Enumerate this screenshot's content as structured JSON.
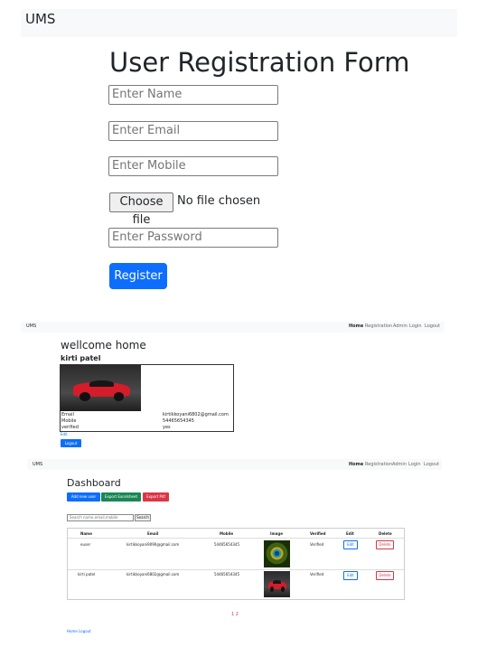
{
  "app": {
    "brand": "UMS"
  },
  "registration": {
    "title": "User Registration Form",
    "name_placeholder": "Enter Name",
    "email_placeholder": "Enter Email",
    "mobile_placeholder": "Enter Mobile",
    "file_button": "Choose file",
    "file_status": "No file chosen",
    "password_placeholder": "Enter Password",
    "submit": "Register"
  },
  "nav_links": [
    "Home",
    "Registration",
    "Admin",
    "Login",
    "Logout"
  ],
  "home": {
    "welcome": "wellcome home",
    "user_name": "kirti patel",
    "fields": [
      {
        "label": "Email",
        "value": "kirtikkoyani6802@gmail.com"
      },
      {
        "label": "Mobile",
        "value": "54465654345"
      },
      {
        "label": "verified",
        "value": "yes"
      }
    ],
    "edit_link": "Edit",
    "logout": "Logout"
  },
  "dashboard": {
    "title": "Dashboard",
    "buttons": {
      "add": "Add new user",
      "excel": "Export Excelsheet",
      "pdf": "Export Pdf"
    },
    "colors": {
      "add": "#0d6efd",
      "excel": "#198754",
      "pdf": "#dc3545"
    },
    "search_placeholder": "Search name,email,mobile",
    "search_button": "Search",
    "columns": [
      "Name",
      "Email",
      "Mobile",
      "Image",
      "Verified",
      "Edit",
      "Delete"
    ],
    "rows": [
      {
        "name": "euser",
        "email": "kirtikkoyani9090@gmail.com",
        "mobile": "54465654345",
        "image": "peacock-feather",
        "verified": "Verified",
        "edit": "Edit",
        "delete": "Delete"
      },
      {
        "name": "kirti patel",
        "email": "kirtikkoyani6802@gmail.com",
        "mobile": "54465654345",
        "image": "red-sports-car",
        "verified": "Verified",
        "edit": "Edit",
        "delete": "Delete"
      }
    ],
    "pagination": "1 2",
    "footer_links": "Home Logout"
  }
}
